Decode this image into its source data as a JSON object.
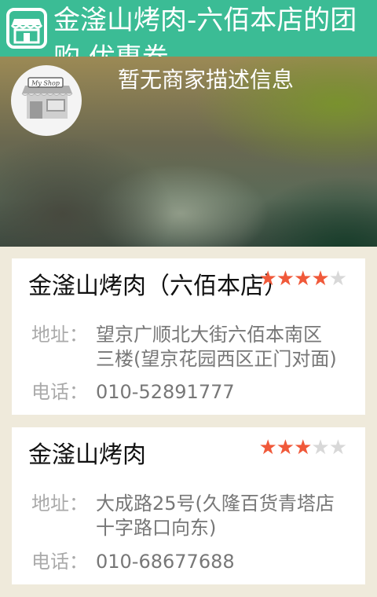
{
  "header": {
    "title": "金滏山烤肉-六佰本店的团购,优惠券"
  },
  "banner": {
    "description": "暂无商家描述信息",
    "avatar_text": "My Shop"
  },
  "stores": [
    {
      "name": "金滏山烤肉（六佰本店）",
      "rating": 4,
      "address_label": "地址：",
      "address": "望京广顺北大街六佰本南区三楼(望京花园西区正门对面)",
      "phone_label": "电话：",
      "phone": "010-52891777"
    },
    {
      "name": "金滏山烤肉",
      "rating": 3,
      "address_label": "地址：",
      "address": "大成路25号(久隆百货青塔店十字路口向东)",
      "phone_label": "电话：",
      "phone": "010-68677688"
    }
  ],
  "colors": {
    "header_bg": "#3bbc95",
    "star_active": "#f0593a",
    "star_inactive": "#d8d8d8"
  }
}
